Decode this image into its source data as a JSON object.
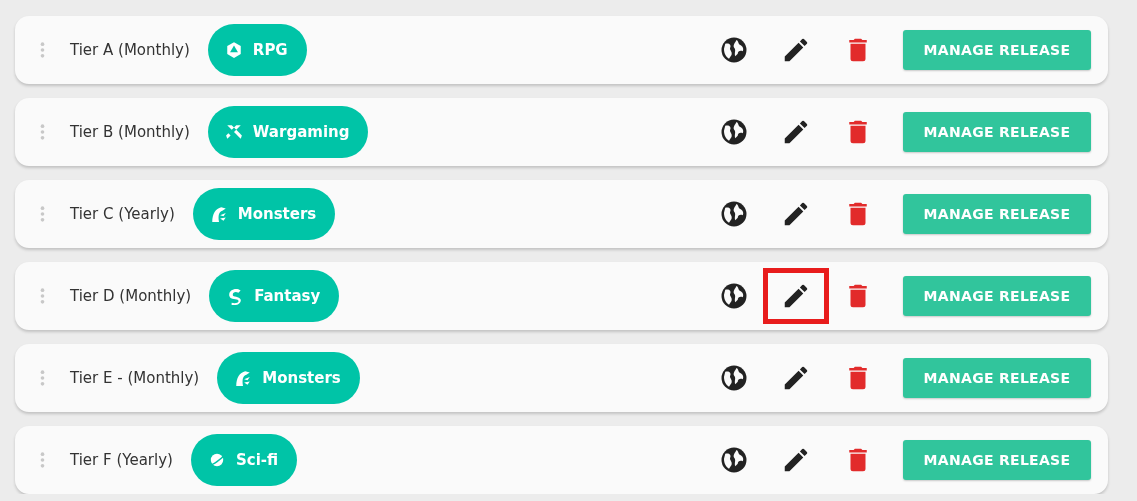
{
  "tiers": [
    {
      "name": "Tier A (Monthly)",
      "genre": {
        "label": "RPG",
        "kind": "dice"
      },
      "edit_highlighted": false,
      "button": "MANAGE RELEASE"
    },
    {
      "name": "Tier B (Monthly)",
      "genre": {
        "label": "Wargaming",
        "kind": "swords"
      },
      "edit_highlighted": false,
      "button": "MANAGE RELEASE"
    },
    {
      "name": "Tier C (Yearly)",
      "genre": {
        "label": "Monsters",
        "kind": "hydra"
      },
      "edit_highlighted": false,
      "button": "MANAGE RELEASE"
    },
    {
      "name": "Tier D (Monthly)",
      "genre": {
        "label": "Fantasy",
        "kind": "dragon"
      },
      "edit_highlighted": true,
      "button": "MANAGE RELEASE"
    },
    {
      "name": "Tier E - (Monthly)",
      "genre": {
        "label": "Monsters",
        "kind": "hydra"
      },
      "edit_highlighted": false,
      "button": "MANAGE RELEASE"
    },
    {
      "name": "Tier F (Yearly)",
      "genre": {
        "label": "Sci-fi",
        "kind": "planet"
      },
      "edit_highlighted": false,
      "button": "MANAGE RELEASE"
    }
  ]
}
